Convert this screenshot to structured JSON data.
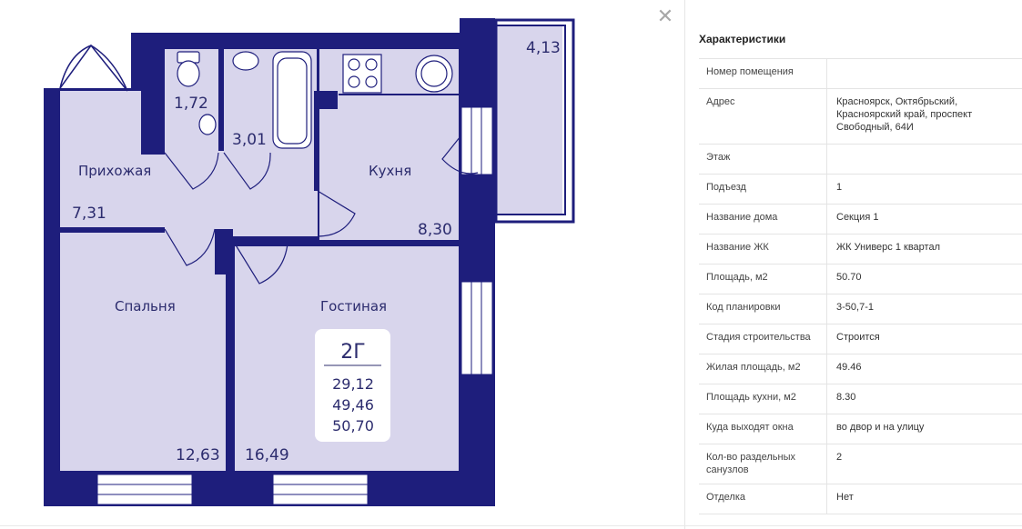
{
  "floor_plan": {
    "rooms": [
      {
        "label": "Прихожая",
        "area": "7,31"
      },
      {
        "label": "Кухня",
        "area": "8,30"
      },
      {
        "label": "Спальня",
        "area": "12,63"
      },
      {
        "label": "Гостиная",
        "area": "16,49"
      },
      {
        "label": "",
        "area": "1,72"
      },
      {
        "label": "",
        "area": "3,01"
      },
      {
        "label": "",
        "area": "4,13"
      }
    ],
    "summary": {
      "type": "2Г",
      "living": "29,12",
      "total_living": "49,46",
      "total": "50,70"
    },
    "colors": {
      "wall": "#1e1e7c",
      "floor": "#d8d5ec",
      "text": "#2c2c6e"
    }
  },
  "close_icon": "✕",
  "panel": {
    "title": "Характеристики",
    "rows": [
      {
        "key": "Номер помещения",
        "value": ""
      },
      {
        "key": "Адрес",
        "value": "Красноярск, Октябрьский, Красноярский край, проспект Свободный, 64И"
      },
      {
        "key": "Этаж",
        "value": ""
      },
      {
        "key": "Подъезд",
        "value": "1"
      },
      {
        "key": "Название дома",
        "value": "Секция 1"
      },
      {
        "key": "Название ЖК",
        "value": "ЖК Универс 1 квартал"
      },
      {
        "key": "Площадь, м2",
        "value": "50.70"
      },
      {
        "key": "Код планировки",
        "value": "3-50,7-1"
      },
      {
        "key": "Стадия строительства",
        "value": "Строится"
      },
      {
        "key": "Жилая площадь, м2",
        "value": "49.46"
      },
      {
        "key": "Площадь кухни, м2",
        "value": "8.30"
      },
      {
        "key": "Куда выходят окна",
        "value": "во двор и на улицу"
      },
      {
        "key": "Кол-во раздельных санузлов",
        "value": "2"
      },
      {
        "key": "Отделка",
        "value": "Нет"
      }
    ]
  }
}
